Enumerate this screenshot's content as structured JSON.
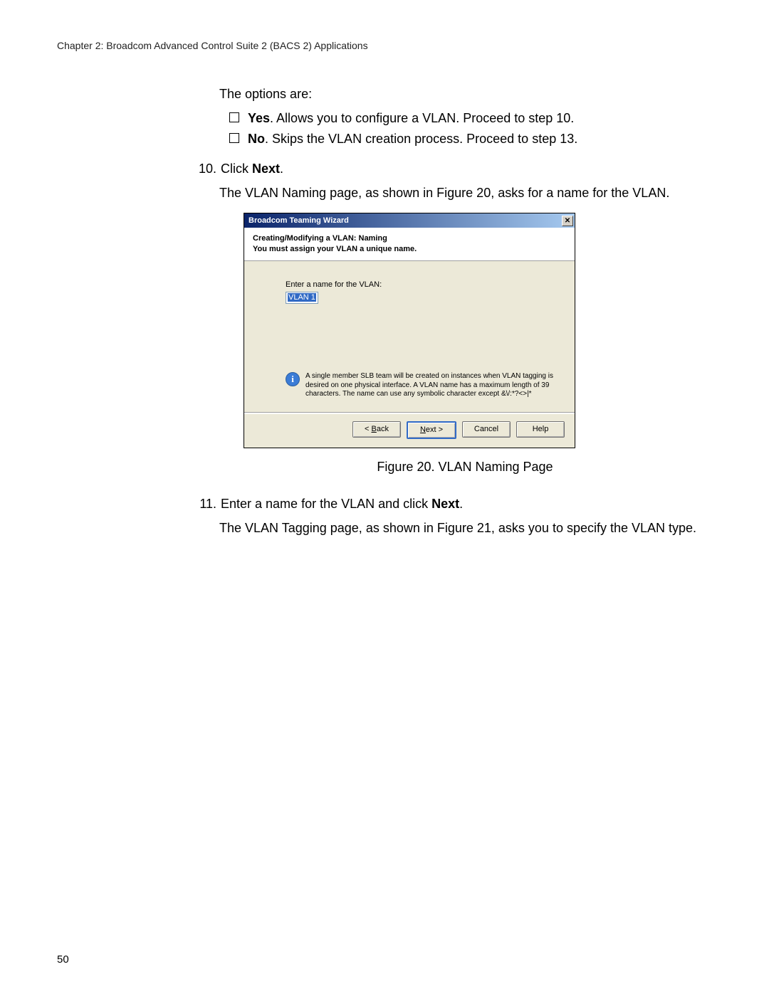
{
  "header": "Chapter 2: Broadcom Advanced Control Suite 2 (BACS 2) Applications",
  "intro": "The options are:",
  "options": [
    {
      "bold": "Yes",
      "rest": ". Allows you to configure a VLAN. Proceed to step 10."
    },
    {
      "bold": "No",
      "rest": ". Skips the VLAN creation process. Proceed to step 13."
    }
  ],
  "step10": {
    "num": "10.",
    "pre": "Click ",
    "bold": "Next",
    "post": "."
  },
  "para1": "The VLAN Naming page, as shown in Figure 20, asks for a name for the VLAN.",
  "figcap": "Figure 20. VLAN Naming Page",
  "step11": {
    "num": "11.",
    "pre": "Enter a name for the VLAN and click ",
    "bold": "Next",
    "post": "."
  },
  "para2": "The VLAN Tagging page, as shown in Figure 21, asks you to specify the VLAN type.",
  "page_number": "50",
  "wizard": {
    "title": "Broadcom Teaming Wizard",
    "close_label": "✕",
    "heading1": "Creating/Modifying a VLAN:  Naming",
    "heading2": "You must assign your VLAN a unique name.",
    "label": "Enter a name for the VLAN:",
    "value": "VLAN 1",
    "info": "A single member SLB team will be created on instances when VLAN tagging is desired on one physical interface.  A VLAN name has a maximum length of 39 characters.  The name can use any symbolic character except  &\\/:*?<>|*",
    "buttons": {
      "back_u": "B",
      "back_rest": "ack",
      "next_u": "N",
      "next_rest": "ext >",
      "cancel": "Cancel",
      "help": "Help"
    }
  }
}
